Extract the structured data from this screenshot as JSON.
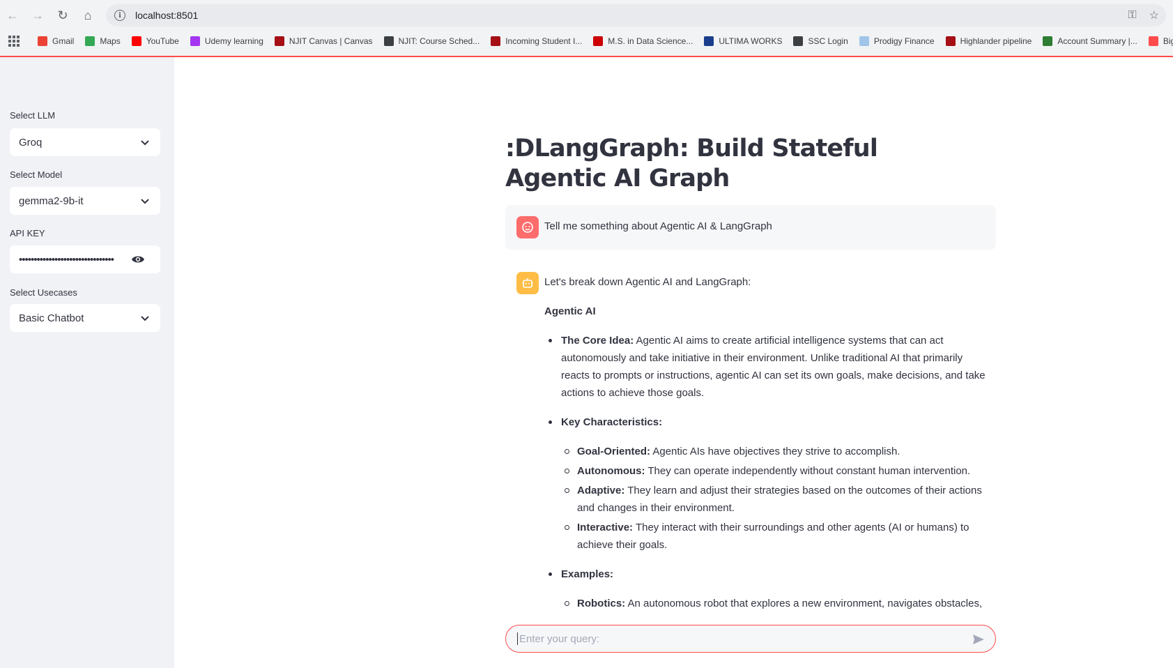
{
  "browser": {
    "url": "localhost:8501",
    "bookmarks": [
      {
        "label": "Gmail",
        "color": "#ea4335"
      },
      {
        "label": "Maps",
        "color": "#34a853"
      },
      {
        "label": "YouTube",
        "color": "#ff0000"
      },
      {
        "label": "Udemy learning",
        "color": "#a435f0"
      },
      {
        "label": "NJIT Canvas | Canvas",
        "color": "#a50f15"
      },
      {
        "label": "NJIT: Course Sched...",
        "color": "#3c4043"
      },
      {
        "label": "Incoming Student I...",
        "color": "#a50f15"
      },
      {
        "label": "M.S. in Data Science...",
        "color": "#cc0000"
      },
      {
        "label": "ULTIMA WORKS",
        "color": "#1a3e8c"
      },
      {
        "label": "SSC Login",
        "color": "#3c4043"
      },
      {
        "label": "Prodigy Finance",
        "color": "#9fc5e8"
      },
      {
        "label": "Highlander pipeline",
        "color": "#a50f15"
      },
      {
        "label": "Account Summary |...",
        "color": "#2e7d32"
      },
      {
        "label": "Big",
        "color": "#ff4b4b"
      }
    ]
  },
  "sidebar": {
    "llm_label": "Select LLM",
    "llm_value": "Groq",
    "model_label": "Select Model",
    "model_value": "gemma2-9b-it",
    "api_label": "API KEY",
    "api_value": "••••••••••••••••••••••••••••••••",
    "usecase_label": "Select Usecases",
    "usecase_value": "Basic Chatbot"
  },
  "main": {
    "title": ":DLangGraph: Build Stateful Agentic AI Graph",
    "user_message": "Tell me something about Agentic AI & LangGraph",
    "bot": {
      "intro": "Let's break down Agentic AI and LangGraph:",
      "heading": "Agentic AI",
      "core_idea_label": "The Core Idea:",
      "core_idea_text": " Agentic AI aims to create artificial intelligence systems that can act autonomously and take initiative in their environment. Unlike traditional AI that primarily reacts to prompts or instructions, agentic AI can set its own goals, make decisions, and take actions to achieve those goals.",
      "key_label": "Key Characteristics:",
      "characteristics": [
        {
          "label": "Goal-Oriented:",
          "text": " Agentic AIs have objectives they strive to accomplish."
        },
        {
          "label": "Autonomous:",
          "text": " They can operate independently without constant human intervention."
        },
        {
          "label": "Adaptive:",
          "text": " They learn and adjust their strategies based on the outcomes of their actions and changes in their environment."
        },
        {
          "label": "Interactive:",
          "text": " They interact with their surroundings and other agents (AI or humans) to achieve their goals."
        }
      ],
      "examples_label": "Examples:",
      "examples": [
        {
          "label": "Robotics:",
          "text": " An autonomous robot that explores a new environment, navigates obstacles, and collects data."
        }
      ]
    },
    "input_placeholder": "Enter your query:"
  },
  "colors": {
    "accent": "#ff4b4b",
    "sidebar_bg": "#f0f2f6",
    "user_avatar": "#ff6c6c",
    "bot_avatar": "#ffbd45"
  }
}
